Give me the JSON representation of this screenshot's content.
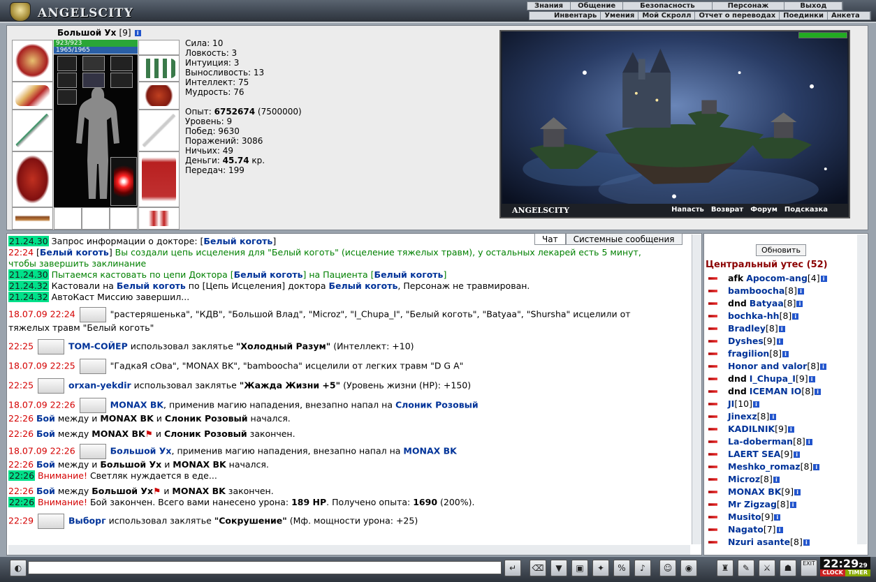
{
  "app": {
    "logo_text": "ANGELSCITY"
  },
  "menu_top": [
    "Знания",
    "Общение",
    "Безопасность",
    "Персонаж",
    "Выход"
  ],
  "menu_sub": [
    "Инвентарь",
    "Умения",
    "Мой Скролл",
    "Отчет о переводах",
    "Поединки",
    "Анкета"
  ],
  "character": {
    "name": "Большой Ух",
    "level": "[9]",
    "hp": "923/923",
    "mp": "1965/1965",
    "stats": [
      "Сила: 10",
      "Ловкость: 3",
      "Интуиция: 3",
      "Выносливость: 13",
      "Интеллект: 75",
      "Мудрость: 76"
    ],
    "exp_label": "Опыт: ",
    "exp_value": "6752674",
    "exp_next": " (7500000)",
    "level_line": "Уровень: 9",
    "wins": "Побед: 9630",
    "losses": "Поражений: 3086",
    "draws": "Ничьих: 49",
    "money_label": "Деньги: ",
    "money_value": "45.74",
    "money_unit": " кр.",
    "transfers": "Передач: 199"
  },
  "scene": {
    "label": "ANGELSCITY",
    "links": [
      "Напасть",
      "Возврат",
      "Форум",
      "Подсказка"
    ]
  },
  "chat": {
    "tabs": [
      "Чат",
      "Системные сообщения"
    ],
    "lines": {
      "l1_ts": "21.24.30",
      "l1_text": " Запрос информации о докторе: [",
      "l1_name": "Белый коготь",
      "l1_end": "]",
      "l2_ts": "22:24",
      "l2_a": " [",
      "l2_name": "Белый коготь",
      "l2_b": "] ",
      "l2_green": "Вы создали цепь исцеления для \"Белый коготь\" (исцеление тяжелых травм), у остальных лекарей есть 5 минут,",
      "l2_green2": "чтобы завершить заклинание",
      "l3_ts": "21.24.30",
      "l3_green": " Пытаемся кастовать по цепи Доктора [",
      "l3_name1": "Белый коготь",
      "l3_mid": "] на Пациента [",
      "l3_name2": "Белый коготь",
      "l3_end": "]",
      "l4_ts": "21.24.32",
      "l4_a": " Кастовали на ",
      "l4_name1": "Белый коготь",
      "l4_b": " по [Цепь Исцеления] доктора ",
      "l4_name2": "Белый коготь",
      "l4_c": ", Персонаж не травмирован.",
      "l5_ts": "21.24.32",
      "l5_text": " АвтоКаст Миссию завершил...",
      "l6_ts": "18.07.09 22:24",
      "l6_text": "\"растеряшенька\", \"КДВ\", \"Большой Влад\", \"Microz\", \"I_Chupa_I\", \"Белый коготь\", \"Batyaa\", \"Shursha\" исцелили от",
      "l6_text2": "тяжелых травм \"Белый коготь\"",
      "l7_ts": "22:25",
      "l7_name": "TOM-СОЙЕР",
      "l7_a": " использовал заклятье ",
      "l7_spell": "\"Холодный Разум\"",
      "l7_b": " (Интеллект: +10)",
      "l8_ts": "18.07.09 22:25",
      "l8_text": "\"ГадкаЯ сОва\", \"MONAX BK\", \"bamboocha\" исцелили от легких травм \"D G A\"",
      "l9_ts": "22:25",
      "l9_name": "orxan-yekdir",
      "l9_a": " использовал заклятье ",
      "l9_spell": "\"Жажда Жизни +5\"",
      "l9_b": " (Уровень жизни (HP): +150)",
      "l10_ts": "18.07.09 22:26",
      "l10_name1": "MONAX BK",
      "l10_a": ", применив магию нападения, внезапно напал на ",
      "l10_name2": "Слоник Розовый",
      "l11_ts": "22:26",
      "l11_boi": "Бой",
      "l11_a": " между и ",
      "l11_n1": "MONAX BK",
      "l11_b": " и ",
      "l11_n2": "Слоник Розовый",
      "l11_c": " начался.",
      "l12_ts": "22:26",
      "l12_boi": "Бой",
      "l12_a": " между ",
      "l12_n1": "MONAX BK",
      "l12_b": " и ",
      "l12_n2": "Слоник Розовый",
      "l12_c": " закончен.",
      "l13_ts": "18.07.09 22:26",
      "l13_name1": "Большой Ух",
      "l13_a": ", применив магию нападения, внезапно напал на ",
      "l13_name2": "MONAX BK",
      "l14_ts": "22:26",
      "l14_boi": "Бой",
      "l14_a": " между и ",
      "l14_n1": "Большой Ух",
      "l14_b": " и ",
      "l14_n2": "MONAX BK",
      "l14_c": " начался.",
      "l15_ts": "22:26",
      "l15_warn": " Внимание!",
      "l15_text": " Светляк нуждается в еде...",
      "l16_ts": "22:26",
      "l16_boi": "Бой",
      "l16_a": " между ",
      "l16_n1": "Большой Ух",
      "l16_b": " и ",
      "l16_n2": "MONAX BK",
      "l16_c": " закончен.",
      "l17_ts": "22:26",
      "l17_warn": " Внимание!",
      "l17_a": " Бой закончен. Всего вами нанесено урона: ",
      "l17_dmg": "189 HP",
      "l17_b": ". Получено опыта: ",
      "l17_exp": "1690",
      "l17_c": " (200%).",
      "l18_ts": "22:29",
      "l18_name": "Выборг",
      "l18_a": " использовал заклятье ",
      "l18_spell": "\"Сокрушение\"",
      "l18_b": " (Мф. мощности урона: +25)"
    }
  },
  "users_panel": {
    "refresh_label": "Обновить",
    "room": "Центральный утес (52)",
    "users": [
      {
        "tag": "afk",
        "name": "Apocom-ang",
        "lvl": "[4]"
      },
      {
        "tag": "",
        "name": "bamboocha",
        "lvl": "[8]"
      },
      {
        "tag": "dnd",
        "name": "Batyaa",
        "lvl": "[8]"
      },
      {
        "tag": "",
        "name": "bochka-hh",
        "lvl": "[8]"
      },
      {
        "tag": "",
        "name": "Bradley",
        "lvl": "[8]"
      },
      {
        "tag": "",
        "name": "Dyshes",
        "lvl": "[9]"
      },
      {
        "tag": "",
        "name": "fragilion",
        "lvl": "[8]"
      },
      {
        "tag": "",
        "name": "Honor and valor",
        "lvl": "[8]"
      },
      {
        "tag": "dnd",
        "name": "I_Chupa_I",
        "lvl": "[9]"
      },
      {
        "tag": "dnd",
        "name": "ICEMAN IO",
        "lvl": "[8]"
      },
      {
        "tag": "",
        "name": "JI",
        "lvl": "[10]"
      },
      {
        "tag": "",
        "name": "Jinexz",
        "lvl": "[8]"
      },
      {
        "tag": "",
        "name": "KADILNIK",
        "lvl": "[9]"
      },
      {
        "tag": "",
        "name": "La-doberman",
        "lvl": "[8]"
      },
      {
        "tag": "",
        "name": "LAERT SEA",
        "lvl": "[9]"
      },
      {
        "tag": "",
        "name": "Meshko_romaz",
        "lvl": "[8]"
      },
      {
        "tag": "",
        "name": "Microz",
        "lvl": "[8]"
      },
      {
        "tag": "",
        "name": "MONAX BK",
        "lvl": "[9]"
      },
      {
        "tag": "",
        "name": "Mr Zigzag",
        "lvl": "[8]"
      },
      {
        "tag": "",
        "name": "Musito",
        "lvl": "[9]"
      },
      {
        "tag": "",
        "name": "Nagato",
        "lvl": "[7]"
      },
      {
        "tag": "",
        "name": "Nzuri asante",
        "lvl": "[8]"
      }
    ]
  },
  "bottom": {
    "exit_label": "EXIT",
    "clock_time": "22:29",
    "clock_sec": "29",
    "clock_label": "CLOCK",
    "timer_label": "TIMER"
  }
}
